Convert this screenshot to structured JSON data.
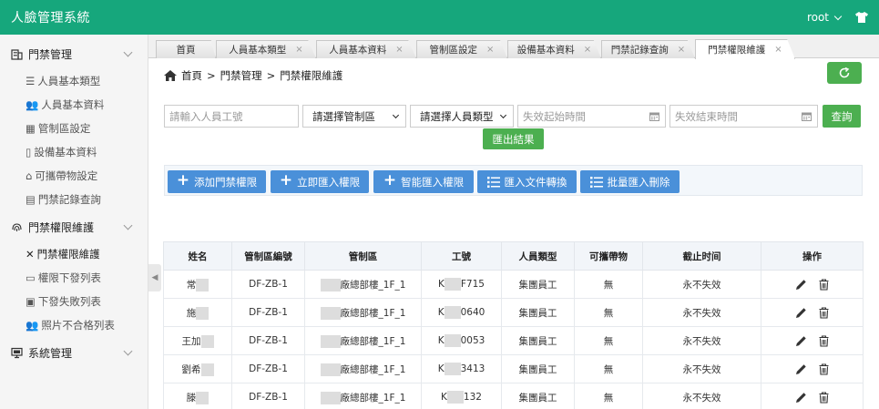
{
  "app": {
    "title": "人臉管理系統",
    "user": "root"
  },
  "sidebar": {
    "groups": [
      {
        "label": "門禁管理",
        "items": [
          "人員基本類型",
          "人員基本資料",
          "管制區設定",
          "設備基本資料",
          "可攜帶物設定",
          "門禁記錄查詢"
        ]
      },
      {
        "label": "門禁權限維護",
        "items": [
          "門禁權限維護",
          "權限下發列表",
          "下發失敗列表",
          "照片不合格列表"
        ]
      },
      {
        "label": "系統管理",
        "items": []
      }
    ]
  },
  "tabs": [
    "首頁",
    "人員基本類型",
    "人員基本資料",
    "管制區設定",
    "設備基本資料",
    "門禁記錄查詢",
    "門禁權限維護"
  ],
  "tab_close": "×",
  "breadcrumb": [
    "首頁",
    "門禁管理",
    "門禁權限維護"
  ],
  "breadcrumb_sep": ">",
  "filters": {
    "employee_placeholder": "請輸入人員工號",
    "area_select": "請選擇管制區",
    "type_select": "請選擇人員類型",
    "start_placeholder": "失效起始時間",
    "end_placeholder": "失效結束時間",
    "query_label": "查詢",
    "export_label": "匯出結果"
  },
  "actions": [
    "添加門禁權限",
    "立即匯入權限",
    "智能匯入權限",
    "匯入文件轉換",
    "批量匯入刪除"
  ],
  "table": {
    "columns": [
      "姓名",
      "管制區編號",
      "管制區",
      "工號",
      "人員類型",
      "可攜帶物",
      "截止时间",
      "操作"
    ],
    "rows": [
      {
        "name": "常",
        "area_code": "DF-ZB-1",
        "area_a": "",
        "area_b": "廠總部樓_1F_1",
        "id_a": "K",
        "id_b": "F715",
        "type": "集團員工",
        "carry": "無",
        "deadline": "永不失效"
      },
      {
        "name": "施",
        "area_code": "DF-ZB-1",
        "area_a": "",
        "area_b": "廠總部樓_1F_1",
        "id_a": "K",
        "id_b": "0640",
        "type": "集團員工",
        "carry": "無",
        "deadline": "永不失效"
      },
      {
        "name": "王加",
        "area_code": "DF-ZB-1",
        "area_a": "",
        "area_b": "廠總部樓_1F_1",
        "id_a": "K",
        "id_b": "0053",
        "type": "集團員工",
        "carry": "無",
        "deadline": "永不失效"
      },
      {
        "name": "劉希",
        "area_code": "DF-ZB-1",
        "area_a": "",
        "area_b": "廠總部樓_1F_1",
        "id_a": "K",
        "id_b": "3413",
        "type": "集團員工",
        "carry": "無",
        "deadline": "永不失效"
      },
      {
        "name": "滕",
        "area_code": "DF-ZB-1",
        "area_a": "",
        "area_b": "廠總部樓_1F_1",
        "id_a": "K",
        "id_b": "132",
        "type": "集團員工",
        "carry": "無",
        "deadline": "永不失效"
      }
    ]
  },
  "colors": {
    "header": "#16a77c",
    "green_button": "#4caf50",
    "blue_button": "#4a90d9"
  }
}
